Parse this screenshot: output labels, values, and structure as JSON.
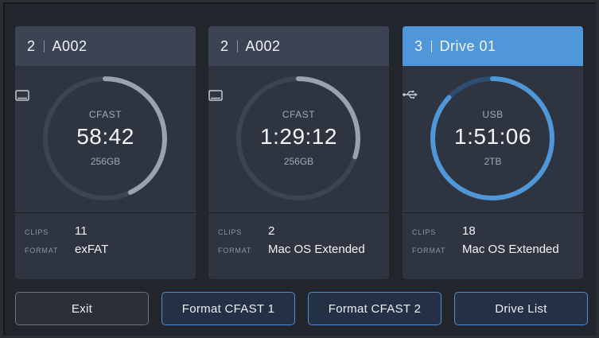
{
  "cards": [
    {
      "slot": "2",
      "name": "A002",
      "media_icon": "cfast-card-icon",
      "media_type": "CFAST",
      "timecode": "58:42",
      "capacity": "256GB",
      "fill_fraction": 0.43,
      "clips_label": "CLIPS",
      "clips_value": "11",
      "format_label": "FORMAT",
      "format_value": "exFAT",
      "active": false
    },
    {
      "slot": "2",
      "name": "A002",
      "media_icon": "cfast-card-icon",
      "media_type": "CFAST",
      "timecode": "1:29:12",
      "capacity": "256GB",
      "fill_fraction": 0.3,
      "clips_label": "CLIPS",
      "clips_value": "2",
      "format_label": "FORMAT",
      "format_value": "Mac OS Extended",
      "active": false
    },
    {
      "slot": "3",
      "name": "Drive 01",
      "media_icon": "usb-icon",
      "media_type": "USB",
      "timecode": "1:51:06",
      "capacity": "2TB",
      "fill_fraction": 0.87,
      "clips_label": "CLIPS",
      "clips_value": "18",
      "format_label": "FORMAT",
      "format_value": "Mac OS Extended",
      "active": true
    }
  ],
  "buttons": {
    "exit": "Exit",
    "format_1": "Format CFAST 1",
    "format_2": "Format CFAST 2",
    "drive_list": "Drive List"
  },
  "colors": {
    "track": "#3c4352",
    "fill_inactive": "#9aa2ae",
    "fill_active": "#4f97d9",
    "active_header": "#4f97d9",
    "button_border_blue": "#4c8fd0"
  }
}
